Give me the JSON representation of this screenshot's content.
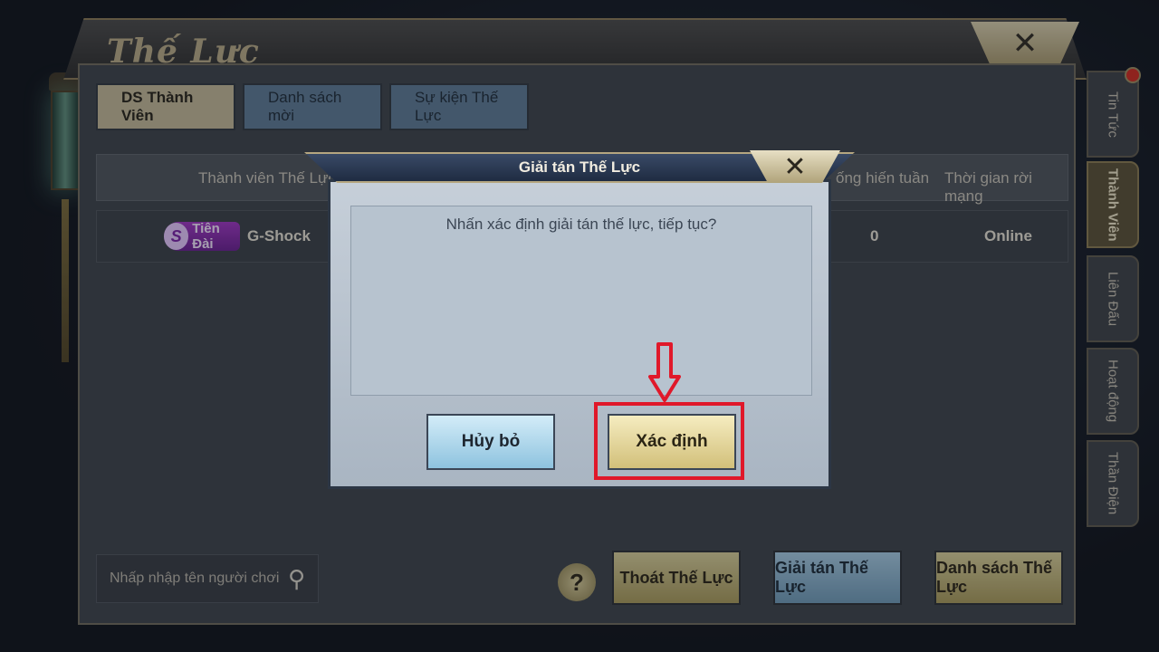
{
  "window": {
    "title": "Thế Lực",
    "close_label": "✕"
  },
  "tabs": [
    {
      "label": "DS Thành Viên"
    },
    {
      "label": "Danh sách mời"
    },
    {
      "label": "Sự kiện Thế Lực"
    }
  ],
  "table": {
    "headers": [
      "Thành viên Thế Lực",
      "ống hiến tuần",
      "Thời gian rời mạng"
    ],
    "rows": [
      {
        "badge": "Tiên Đài",
        "name": "G-Shock",
        "contribution": "0",
        "offline": "Online"
      }
    ]
  },
  "bottom": {
    "search_placeholder": "Nhấp nhập tên người chơi",
    "help_label": "?",
    "leave_label": "Thoát Thế Lực",
    "disband_label": "Giải tán Thế Lực",
    "list_label": "Danh sách Thế Lực"
  },
  "side_tabs": [
    {
      "label": "Tin Tức"
    },
    {
      "label": "Thành Viên"
    },
    {
      "label": "Liên Đấu"
    },
    {
      "label": "Hoạt động"
    },
    {
      "label": "Thần Điện"
    }
  ],
  "dialog": {
    "title": "Giải tán Thế Lực",
    "close_label": "✕",
    "message": "Nhấn xác định giải tán thế lực, tiếp tục?",
    "cancel_label": "Hủy bỏ",
    "confirm_label": "Xác  định"
  },
  "colors": {
    "highlight": "#e0182a",
    "gold": "#d2c07a",
    "blue": "#8ec3df"
  }
}
